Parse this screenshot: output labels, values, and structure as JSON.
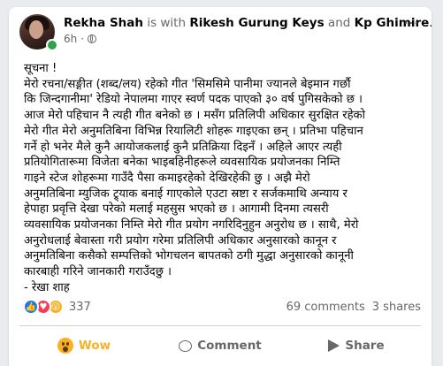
{
  "post": {
    "author": "Rekha Shah",
    "with_text": "is with",
    "tagged_1": "Rikesh Gurung Keys",
    "and_text": "and",
    "tagged_2": "Kp Ghimire",
    "time": "6h",
    "dot": "·",
    "more_icon": "more-dots-icon",
    "privacy_icon": "globe-icon",
    "body_lines": [
      "सूचना !",
      "मेरो रचना/सङ्गीत (शब्द/लय) रहेको गीत 'सिमसिमे पानीमा ज्यानले बेइमान गर्छौ",
      "कि जिन्दगानीमा' रेडियो नेपालमा गाएर स्वर्ण पदक पाएको ३० वर्ष पुगिसकेको छ ।",
      "आज मेरो पहिचान नै त्यही गीत बनेको छ । मसँग प्रतिलिपी अधिकार सुरक्षित रहेको",
      "मेरो गीत मेरो अनुमतिबिना विभिन्न रियालिटी शोहरू गाइएका छन् । प्रतिभा पहिचान",
      "गर्ने हो भनेर मैले कुनै आयोजकलाई कुनै प्रतिक्रिया दिइनँ । अहिले आएर त्यही",
      "प्रतियोगितारूमा विजेता बनेका भाइबहिनीहरूले व्यवसायिक प्रयोजनका निम्ति",
      "गाइने स्टेज शोहरूमा गाउँदै पैसा कमाइरहेको देखिरहेकी छु । अझै मेरो",
      "अनुमतिबिना म्युजिक ट्र्याक बनाई गाएकोले एउटा स्रष्टा र सर्जकमाथि अन्याय र",
      "हेपाहा प्रवृत्ति देखा परेको मलाई महसुस भएको छ । आगामी दिनमा त्यसरी",
      "व्यवसायिक प्रयोजनका निम्ति मेरो गीत प्रयोग नगरिदिनुहुन अनुरोध छ । साथै, मेरो",
      "अनुरोधलाई बेवास्ता गरी प्रयोग गरेमा प्रतिलिपी अधिकार अनुसारको कानून र",
      "अनुमतिबिना कसैको सम्पत्तिको भोगचलन बापतको ठगी मुद्धा अनुसारको कानूनी",
      "कारबाही गरिने जानकारी गराउँदछु ।",
      "- रेखा शाह"
    ],
    "reactions": {
      "count": "337",
      "types": [
        "like",
        "love",
        "wow"
      ]
    },
    "comments": "69 comments",
    "shares": "3 shares",
    "actions": {
      "wow_label": "Wow",
      "comment_label": "Comment",
      "share_label": "Share"
    },
    "colors": {
      "like": "#1877f2",
      "love": "#f33e58",
      "wow": "#f7b125",
      "online": "#31a24c"
    }
  }
}
